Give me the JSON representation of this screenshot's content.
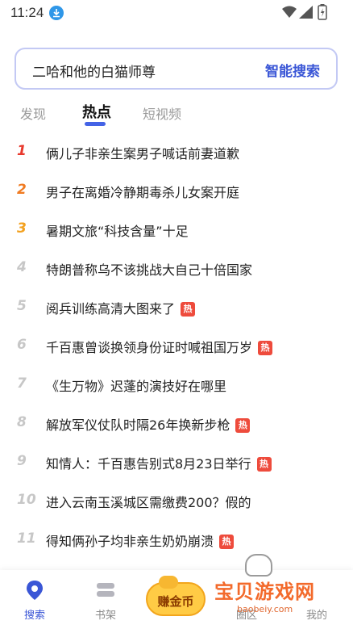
{
  "status_bar": {
    "time": "11:24"
  },
  "search": {
    "query": "二哈和他的白猫师尊",
    "action_label": "智能搜索"
  },
  "tabs": [
    {
      "label": "发现",
      "active": false
    },
    {
      "label": "热点",
      "active": true
    },
    {
      "label": "短视频",
      "active": false
    }
  ],
  "hot_list": [
    {
      "rank": "1",
      "title": "俩儿子非亲生案男子喊话前妻道歉",
      "badge": ""
    },
    {
      "rank": "2",
      "title": "男子在离婚冷静期毒杀儿女案开庭",
      "badge": ""
    },
    {
      "rank": "3",
      "title": "暑期文旅“科技含量”十足",
      "badge": ""
    },
    {
      "rank": "4",
      "title": "特朗普称乌不该挑战大自己十倍国家",
      "badge": ""
    },
    {
      "rank": "5",
      "title": "阅兵训练高清大图来了",
      "badge": "热"
    },
    {
      "rank": "6",
      "title": "千百惠曾谈换领身份证时喊祖国万岁",
      "badge": "热"
    },
    {
      "rank": "7",
      "title": "《生万物》迟蓬的演技好在哪里",
      "badge": ""
    },
    {
      "rank": "8",
      "title": "解放军仪仗队时隔26年换新步枪",
      "badge": "热"
    },
    {
      "rank": "9",
      "title": "知情人：千百惠告别式8月23日举行",
      "badge": "热"
    },
    {
      "rank": "10",
      "title": "进入云南玉溪城区需缴费200？假的",
      "badge": ""
    },
    {
      "rank": "11",
      "title": "得知俩孙子均非亲生奶奶崩溃",
      "badge": "热"
    }
  ],
  "bottom_nav": {
    "search_label": "搜索",
    "bookshelf_label": "书架",
    "earn_label": "赚金币",
    "discover_label": "圈区",
    "mine_label": "我的"
  },
  "watermark": {
    "title": "宝贝游戏网",
    "url": "baobeiy.com"
  },
  "colors": {
    "accent": "#3a56d6",
    "hot_badge": "#ee4b3c",
    "rank1": "#e8392d",
    "rank2": "#f07b22",
    "rank3": "#f3a11f"
  }
}
